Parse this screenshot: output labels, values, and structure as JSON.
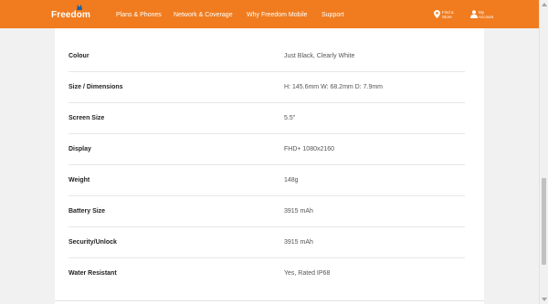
{
  "header": {
    "logo_text": "Freedom",
    "nav": [
      "Plans & Phones",
      "Network & Coverage",
      "Why Freedom Mobile",
      "Support"
    ],
    "find_store": "Find a Store",
    "my_account": "My Account",
    "brand_color": "#f07c1f",
    "icons": [
      "freedom-logo-mark-icon",
      "map-pin-icon",
      "user-icon"
    ]
  },
  "specs": [
    {
      "label": "Colour",
      "value": "Just Black, Clearly White"
    },
    {
      "label": "Size / Dimensions",
      "value": "H: 145.6mm W: 68.2mm D: 7.9mm"
    },
    {
      "label": "Screen Size",
      "value": "5.5\""
    },
    {
      "label": "Display",
      "value": "FHD+ 1080x2160"
    },
    {
      "label": "Weight",
      "value": "148g"
    },
    {
      "label": "Battery Size",
      "value": "3915 mAh"
    },
    {
      "label": "Security/Unlock",
      "value": "3915 mAh"
    },
    {
      "label": "Water Resistant",
      "value": "Yes, Rated IP68"
    }
  ]
}
